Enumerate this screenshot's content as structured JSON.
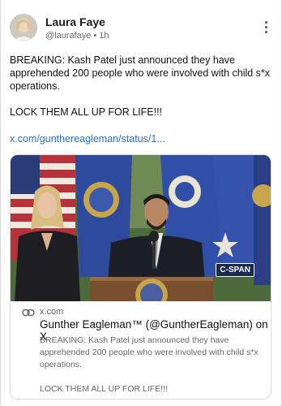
{
  "author": {
    "name": "Laura Faye",
    "handle": "@laurafaye",
    "separator": "•",
    "time": "1h"
  },
  "post": {
    "text": "BREAKING: Kash Patel just announced they have apprehended 200 people who were involved with child s*x operations.\n\nLOCK THEM ALL UP FOR LIFE!!!",
    "link": "x.com/gunthereagleman/status/1..."
  },
  "link_card": {
    "domain": "x.com",
    "title": "Gunther Eagleman™ (@GuntherEagleman) on X",
    "description": "BREAKING: Kash Patel just announced they have apprehended 200 people who were involved with child s*x operations.\n\nLOCK THEM ALL UP FOR LIFE!!!",
    "image_watermark": "C-SPAN"
  },
  "colors": {
    "link": "#2f6fd0",
    "secondary_text": "#6b6b6b",
    "border": "#dadada"
  },
  "icons": [
    "kebab-menu-icon",
    "link-icon"
  ]
}
